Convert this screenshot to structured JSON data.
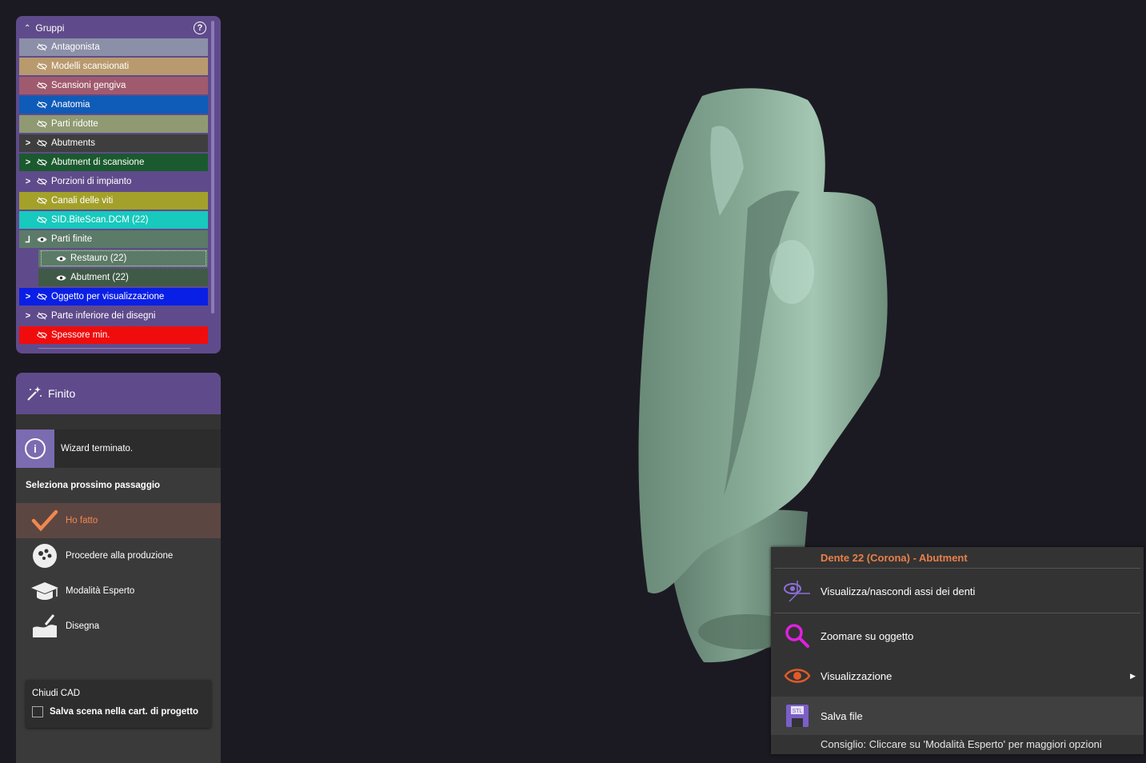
{
  "groups_panel": {
    "title": "Gruppi",
    "help": "?",
    "items": [
      {
        "label": "Antagonista",
        "bg": "#8b8fa8",
        "expander": "",
        "visible": false
      },
      {
        "label": "Modelli scansionati",
        "bg": "#b89a6e",
        "expander": "",
        "visible": false
      },
      {
        "label": "Scansioni gengiva",
        "bg": "#a05a6e",
        "expander": "",
        "visible": false
      },
      {
        "label": "Anatomia",
        "bg": "#0f5bb8",
        "expander": "",
        "visible": false
      },
      {
        "label": "Parti ridotte",
        "bg": "#8f9a72",
        "expander": "",
        "visible": false
      },
      {
        "label": "Abutments",
        "bg": "#3e3e3e",
        "expander": ">",
        "visible": false
      },
      {
        "label": "Abutment di scansione",
        "bg": "#1b5a2e",
        "expander": ">",
        "visible": false
      },
      {
        "label": "Porzioni di impianto",
        "bg": "#5f4b8b",
        "expander": ">",
        "visible": false
      },
      {
        "label": "Canali delle viti",
        "bg": "#a3a12a",
        "expander": "",
        "visible": false
      },
      {
        "label": "SID.BiteScan.DCM (22)",
        "bg": "#18c9bd",
        "expander": "",
        "visible": false
      },
      {
        "label": "Parti finite",
        "bg": "#5c7a68",
        "expander": "⅃",
        "visible": true
      },
      {
        "label": "Restauro (22)",
        "bg": "#5c7a68",
        "expander": "",
        "visible": true,
        "child": true,
        "selected": true
      },
      {
        "label": "Abutment (22)",
        "bg": "#3f5a46",
        "expander": "",
        "visible": true,
        "child": true
      },
      {
        "label": "Oggetto per visualizzazione",
        "bg": "#0a1fe6",
        "expander": ">",
        "visible": false
      },
      {
        "label": "Parte inferiore dei disegni",
        "bg": "#5f4b8b",
        "expander": ">",
        "visible": false
      },
      {
        "label": "Spessore min.",
        "bg": "#f00c0c",
        "expander": "",
        "visible": false
      }
    ]
  },
  "wizard_panel": {
    "title": "Finito",
    "info": "Wizard terminato.",
    "select_title": "Seleziona prossimo passaggio",
    "steps": [
      {
        "label": "Ho fatto",
        "icon": "checkmark-icon",
        "active": true
      },
      {
        "label": "Procedere alla produzione",
        "icon": "production-icon",
        "active": false
      },
      {
        "label": "Modalità Esperto",
        "icon": "graduation-cap-icon",
        "active": false
      },
      {
        "label": "Disegna",
        "icon": "draw-icon",
        "active": false
      }
    ],
    "close_cad": {
      "title": "Chiudi CAD",
      "checkbox_label": "Salva scena nella cart. di progetto",
      "checked": false
    }
  },
  "context_menu": {
    "title": "Dente 22 (Corona) - Abutment",
    "items": [
      {
        "label": "Visualizza/nascondi assi dei denti",
        "icon": "axis-eye-icon"
      },
      {
        "label": "Zoomare su oggetto",
        "icon": "magnifier-icon"
      },
      {
        "label": "Visualizzazione",
        "icon": "eye-icon",
        "submenu": true
      },
      {
        "label": "Salva file",
        "icon": "stl-save-icon"
      }
    ],
    "tip": "Consiglio: Cliccare su 'Modalità Esperto' per maggiori opzioni"
  },
  "colors": {
    "accent": "#5f4b8b",
    "highlight": "#e8804a",
    "model": "#7fa08d"
  }
}
